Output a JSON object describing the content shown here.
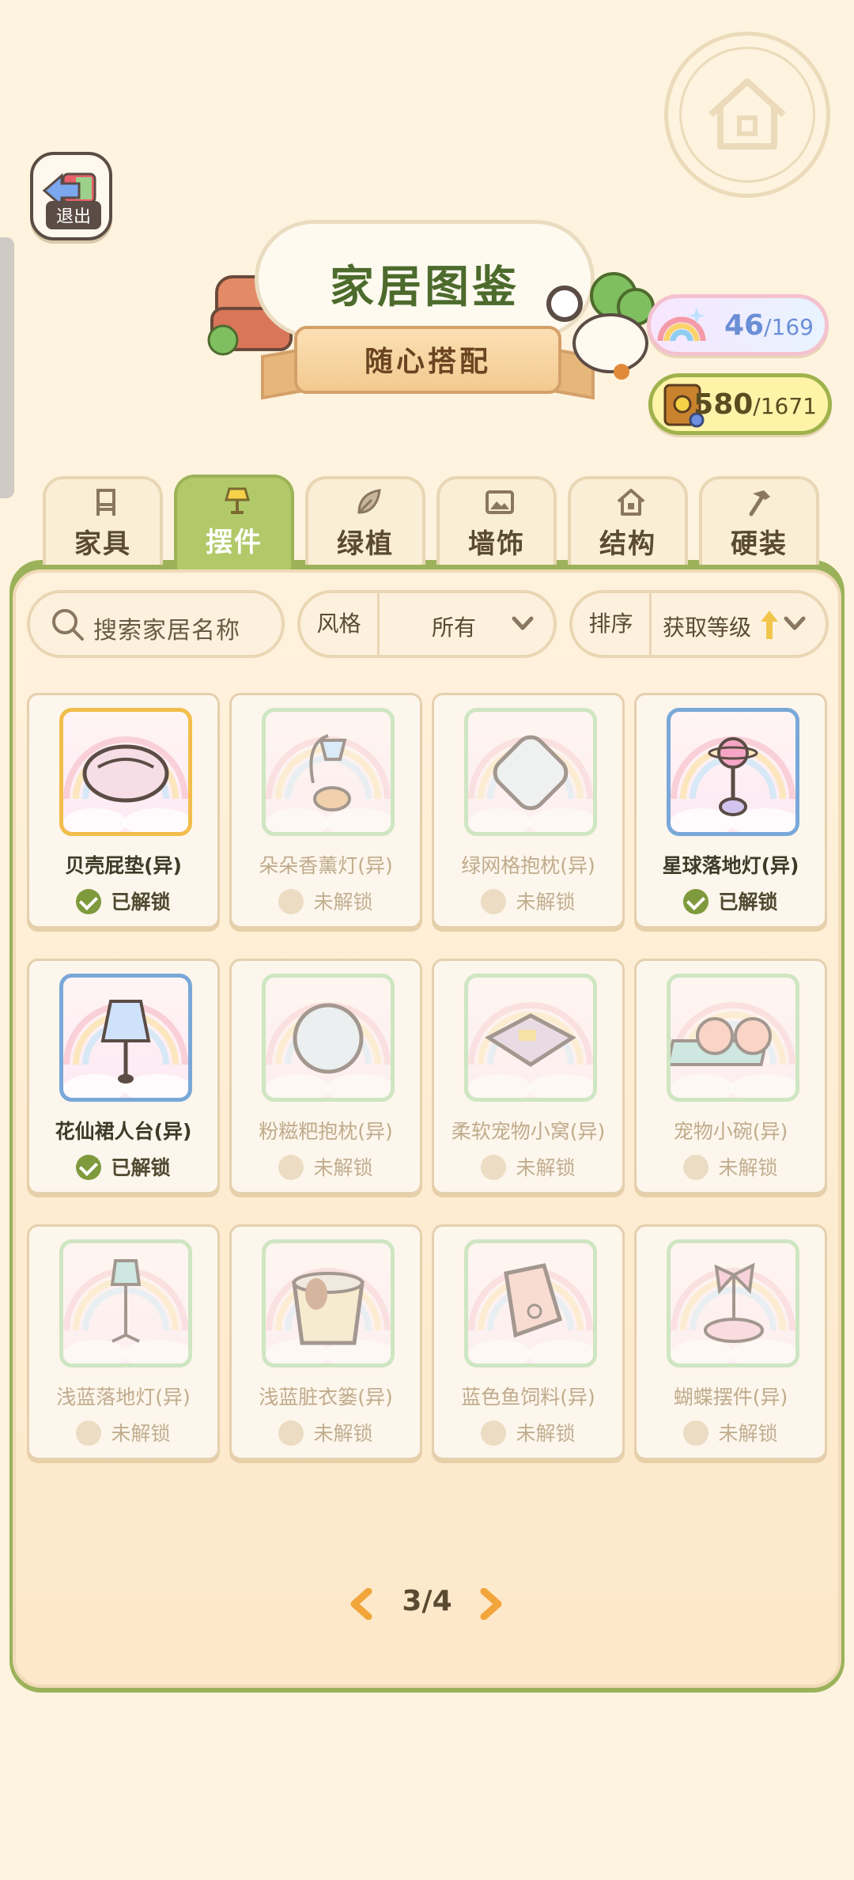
{
  "header": {
    "exit_label": "退出",
    "title": "家居图鉴",
    "subtitle": "随心搭配"
  },
  "counters": {
    "collected": "46",
    "collected_total": "/169",
    "points": "580",
    "points_total": "/1671"
  },
  "tabs": [
    {
      "label": "家具",
      "icon": "chair-icon"
    },
    {
      "label": "摆件",
      "icon": "lamp-icon"
    },
    {
      "label": "绿植",
      "icon": "leaf-icon"
    },
    {
      "label": "墙饰",
      "icon": "picture-icon"
    },
    {
      "label": "结构",
      "icon": "house-icon"
    },
    {
      "label": "硬装",
      "icon": "hammer-icon"
    }
  ],
  "active_tab": "摆件",
  "filters": {
    "search_placeholder": "搜索家居名称",
    "style_key": "风格",
    "style_value": "所有",
    "sort_key": "排序",
    "sort_value": "获取等级"
  },
  "items": [
    {
      "name": "贝壳屁垫(异)",
      "status": "已解锁",
      "unlocked": true
    },
    {
      "name": "朵朵香薰灯(异)",
      "status": "未解锁",
      "unlocked": false
    },
    {
      "name": "绿网格抱枕(异)",
      "status": "未解锁",
      "unlocked": false
    },
    {
      "name": "星球落地灯(异)",
      "status": "已解锁",
      "unlocked": true
    },
    {
      "name": "花仙裙人台(异)",
      "status": "已解锁",
      "unlocked": true
    },
    {
      "name": "粉糍粑抱枕(异)",
      "status": "未解锁",
      "unlocked": false
    },
    {
      "name": "柔软宠物小窝(异)",
      "status": "未解锁",
      "unlocked": false
    },
    {
      "name": "宠物小碗(异)",
      "status": "未解锁",
      "unlocked": false
    },
    {
      "name": "浅蓝落地灯(异)",
      "status": "未解锁",
      "unlocked": false
    },
    {
      "name": "浅蓝脏衣篓(异)",
      "status": "未解锁",
      "unlocked": false
    },
    {
      "name": "蓝色鱼饲料(异)",
      "status": "未解锁",
      "unlocked": false
    },
    {
      "name": "蝴蝶摆件(异)",
      "status": "未解锁",
      "unlocked": false
    }
  ],
  "pagination": {
    "label": "3/4"
  },
  "colors": {
    "accent_green": "#9bb25a",
    "unlocked_check": "#7e9a3d",
    "background": "#fdf3de"
  }
}
